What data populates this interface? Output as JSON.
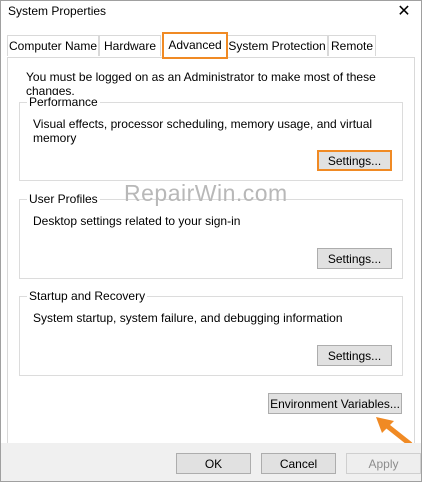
{
  "window": {
    "title": "System Properties",
    "close_glyph": "✕"
  },
  "tabs": [
    {
      "label": "Computer Name"
    },
    {
      "label": "Hardware"
    },
    {
      "label": "Advanced",
      "active": true
    },
    {
      "label": "System Protection"
    },
    {
      "label": "Remote"
    }
  ],
  "admin_note": "You must be logged on as an Administrator to make most of these changes.",
  "performance": {
    "title": "Performance",
    "description": "Visual effects, processor scheduling, memory usage, and virtual memory",
    "button": "Settings..."
  },
  "user_profiles": {
    "title": "User Profiles",
    "description": "Desktop settings related to your sign-in",
    "button": "Settings..."
  },
  "startup_recovery": {
    "title": "Startup and Recovery",
    "description": "System startup, system failure, and debugging information",
    "button": "Settings..."
  },
  "environment_button": "Environment Variables...",
  "watermark": "RepairWin.com",
  "footer": {
    "ok": "OK",
    "cancel": "Cancel",
    "apply": "Apply"
  },
  "colors": {
    "highlight": "#f08a24",
    "button_face": "#e1e1e1",
    "footer_bg": "#f0f0f0"
  }
}
